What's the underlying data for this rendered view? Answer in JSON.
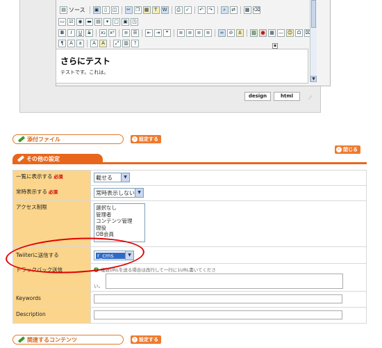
{
  "editor": {
    "source_label": "ソース",
    "heading": "さらにテスト",
    "body_text": "テストです。これは。",
    "modes": [
      "design",
      "html"
    ]
  },
  "attachments": {
    "label": "添付ファイル",
    "set_button": "設定する"
  },
  "other_settings": {
    "label": "その他の設定",
    "close_button": "閉じる"
  },
  "form": {
    "required_label": "必須",
    "rows": {
      "list_display": {
        "label": "一覧に表示する",
        "value": "載せる"
      },
      "always_display": {
        "label": "常時表示する",
        "value": "常時表示しない"
      },
      "access": {
        "label": "アクセス制限",
        "options": [
          "選択なし",
          "管理者",
          "コンテンツ管理",
          "現役",
          "OB会員"
        ]
      },
      "twitter": {
        "label": "Twiiterに送信する",
        "value": "r_cms"
      },
      "trackback": {
        "label": "トラックバック送信",
        "hint": "複数URLを送る場合は改行して一行に1URL書いてくださ",
        "hint_tail": "い。"
      },
      "keywords": {
        "label": "Keywords"
      },
      "description": {
        "label": "Description"
      }
    }
  },
  "related": {
    "label": "関連するコンテンツ",
    "set_button": "設定する"
  },
  "colors": {
    "accent": "#e8661c",
    "label_bg": "#fbd58b",
    "highlight": "#e00000"
  }
}
